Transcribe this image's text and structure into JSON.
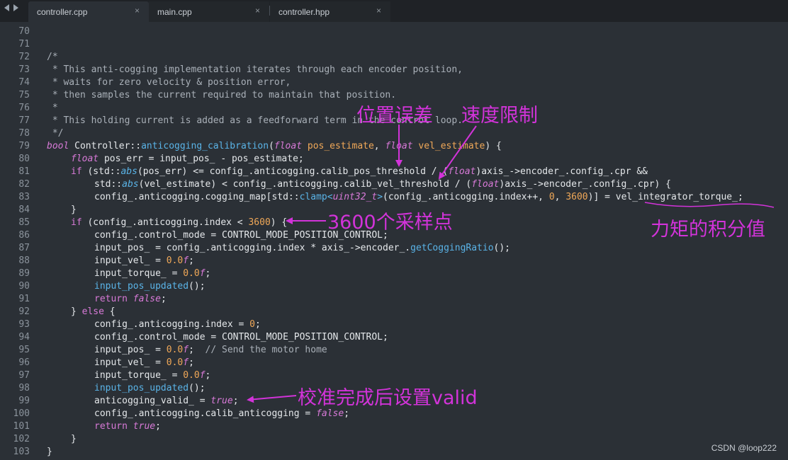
{
  "tabs": [
    {
      "label": "controller.cpp",
      "active": true
    },
    {
      "label": "main.cpp",
      "active": false
    },
    {
      "label": "controller.hpp",
      "active": false
    }
  ],
  "close_glyph": "×",
  "line_numbers": [
    "70",
    "71",
    "72",
    "73",
    "74",
    "75",
    "76",
    "77",
    "78",
    "79",
    "80",
    "81",
    "82",
    "83",
    "84",
    "85",
    "86",
    "87",
    "88",
    "89",
    "90",
    "91",
    "92",
    "93",
    "94",
    "95",
    "96",
    "97",
    "98",
    "99",
    "100",
    "101",
    "102",
    "103"
  ],
  "code": {
    "l72": "/*",
    "l73": " * This anti-cogging implementation iterates through each encoder position,",
    "l74": " * waits for zero velocity & position error,",
    "l75": " * then samples the current required to maintain that position.",
    "l76": " *",
    "l77": " * This holding current is added as a feedforward term in the control loop.",
    "l78": " */",
    "l79_kw": "bool",
    "l79_class": " Controller::",
    "l79_fn": "anticogging_calibration",
    "l79_open": "(",
    "l79_t1": "float",
    "l79_p1": " pos_estimate",
    "l79_comma": ", ",
    "l79_t2": "float",
    "l79_p2": " vel_estimate",
    "l79_close": ") {",
    "l80_t": "float",
    "l80_rest": " pos_err = input_pos_ - pos_estimate;",
    "l81_if": "if",
    "l81_a": " (std::",
    "l81_abs": "abs",
    "l81_b": "(pos_err) <= config_.anticogging.calib_pos_threshold / (",
    "l81_f": "float",
    "l81_c": ")axis_->encoder_.config_.cpr &&",
    "l82_a": "std::",
    "l82_abs": "abs",
    "l82_b": "(vel_estimate) < config_.anticogging.calib_vel_threshold / (",
    "l82_f": "float",
    "l82_c": ")axis_->encoder_.config_.cpr) {",
    "l83_a": "config_.anticogging.cogging_map[std::",
    "l83_clamp": "clamp",
    "l83_lt": "<",
    "l83_t": "uint32_t",
    "l83_gt": ">",
    "l83_b": "(config_.anticogging.index++, ",
    "l83_n0": "0",
    "l83_c": ", ",
    "l83_n1": "3600",
    "l83_d": ")] = vel_integrator_torque_;",
    "l84": "}",
    "l85_if": "if",
    "l85_a": " (config_.anticogging.index < ",
    "l85_n": "3600",
    "l85_b": ") {",
    "l86": "config_.control_mode = CONTROL_MODE_POSITION_CONTROL;",
    "l87_a": "input_pos_ = config_.anticogging.index * axis_->encoder_.",
    "l87_fn": "getCoggingRatio",
    "l87_b": "();",
    "l88_a": "input_vel_ = ",
    "l88_n": "0.0",
    "l88_f": "f",
    "l88_b": ";",
    "l89_a": "input_torque_ = ",
    "l89_n": "0.0",
    "l89_f": "f",
    "l89_b": ";",
    "l90_fn": "input_pos_updated",
    "l90_b": "();",
    "l91_kw": "return",
    "l91_v": " false",
    "l91_b": ";",
    "l92_a": "} ",
    "l92_kw": "else",
    "l92_b": " {",
    "l93_a": "config_.anticogging.index = ",
    "l93_n": "0",
    "l93_b": ";",
    "l94": "config_.control_mode = CONTROL_MODE_POSITION_CONTROL;",
    "l95_a": "input_pos_ = ",
    "l95_n": "0.0",
    "l95_f": "f",
    "l95_b": ";  ",
    "l95_cm": "// Send the motor home",
    "l96_a": "input_vel_ = ",
    "l96_n": "0.0",
    "l96_f": "f",
    "l96_b": ";",
    "l97_a": "input_torque_ = ",
    "l97_n": "0.0",
    "l97_f": "f",
    "l97_b": ";",
    "l98_fn": "input_pos_updated",
    "l98_b": "();",
    "l99_a": "anticogging_valid_ = ",
    "l99_v": "true",
    "l99_b": ";",
    "l100_a": "config_.anticogging.calib_anticogging = ",
    "l100_v": "false",
    "l100_b": ";",
    "l101_kw": "return",
    "l101_v": " true",
    "l101_b": ";",
    "l102": "}",
    "l103": "}"
  },
  "annotations": {
    "pos_error": "位置误差",
    "vel_limit": "速度限制",
    "samples": "3600个采样点",
    "torque": "力矩的积分值",
    "valid": "校准完成后设置valid"
  },
  "annotation_color": "#d233d9",
  "watermark": "CSDN @loop222"
}
